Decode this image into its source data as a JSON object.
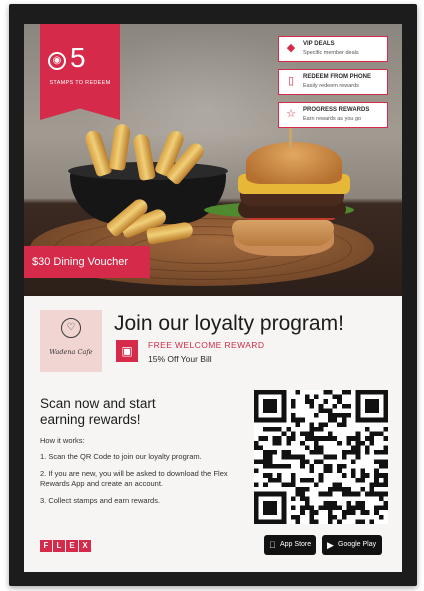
{
  "hero": {
    "stamps_count": "5",
    "stamps_label": "STAMPS TO REDEEM",
    "voucher": "$30 Dining Voucher",
    "features": [
      {
        "title": "VIP DEALS",
        "subtitle": "Specific member deals",
        "icon": "diamond-icon"
      },
      {
        "title": "REDEEM FROM PHONE",
        "subtitle": "Easily redeem rewards",
        "icon": "phone-icon"
      },
      {
        "title": "PROGRESS REWARDS",
        "subtitle": "Earn rewards as you go",
        "icon": "star-icon"
      }
    ]
  },
  "brand": {
    "logo_name": "Wadena Cafe"
  },
  "main": {
    "title": "Join our loyalty program!",
    "reward_label": "FREE WELCOME REWARD",
    "reward_offer": "15% Off Your Bill",
    "scan_heading_line1": "Scan now and start",
    "scan_heading_line2": "earning rewards!",
    "how_it_works": "How it works:",
    "steps": [
      "1. Scan the QR Code to join our loyalty program.",
      "2. If you are new, you will be asked to download the Flex Rewards App and create an account.",
      "3. Collect stamps and earn rewards."
    ]
  },
  "footer": {
    "flex_letters": [
      "F",
      "L",
      "E",
      "X"
    ],
    "app_store": "App Store",
    "google_play": "Google Play"
  },
  "colors": {
    "accent": "#d52a4a",
    "frame": "#1c1c1c",
    "logo_bg": "#f0d5d3"
  }
}
